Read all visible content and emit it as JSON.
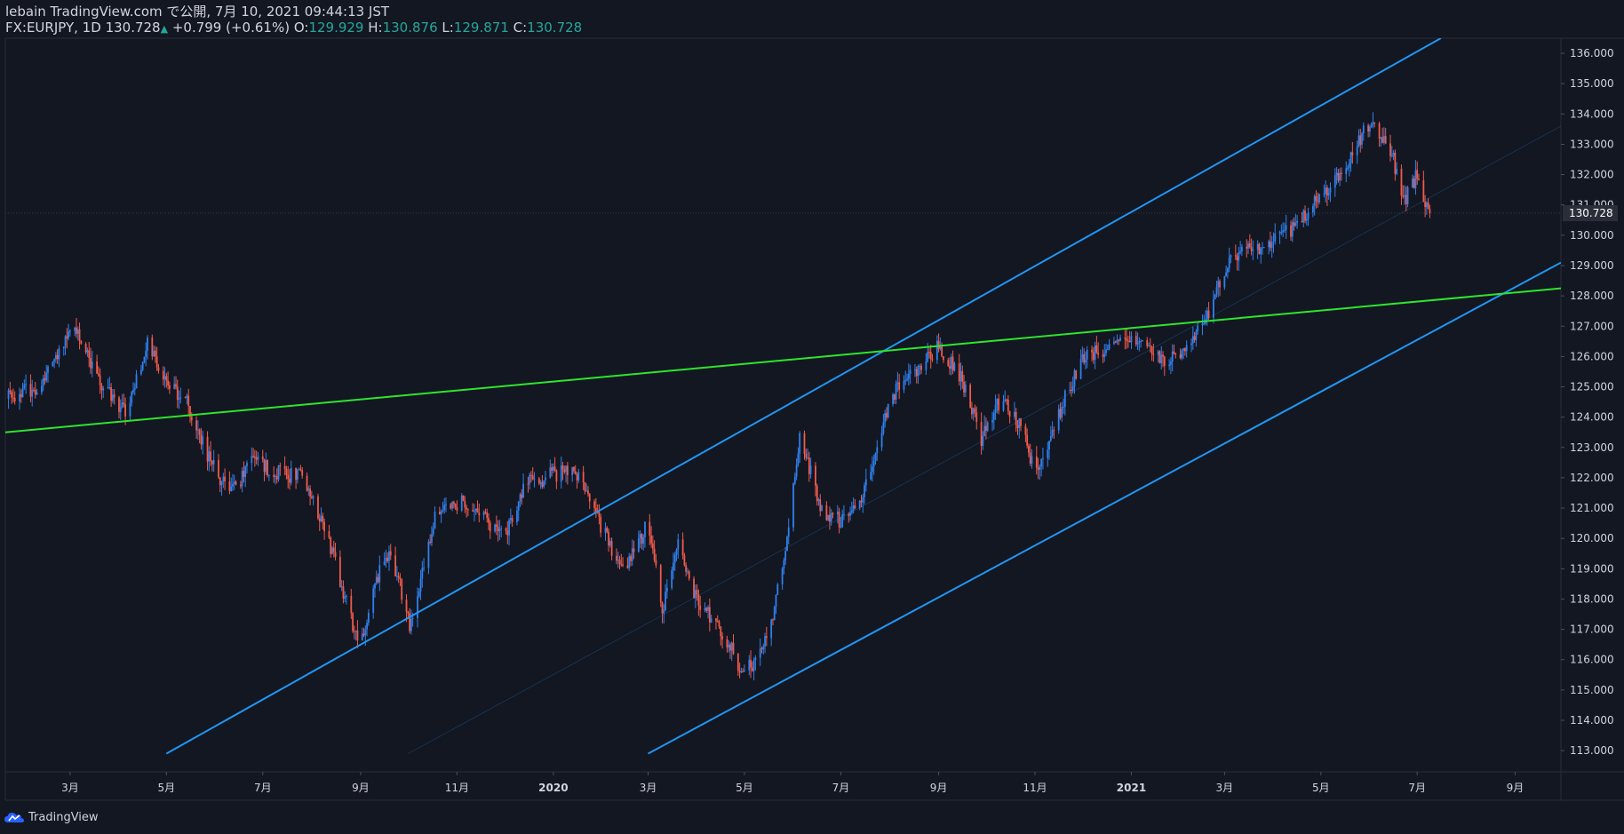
{
  "header": {
    "publish_line": "lebain TradingView.com で公開, 7月 10, 2021 09:44:13 JST",
    "symbol": "FX:EURJPY, 1D",
    "last": "130.728",
    "change_arrow": "▲",
    "change": "+0.799 (+0.61%)",
    "o_label": "O:",
    "o_value": "129.929",
    "h_label": "H:",
    "h_value": "130.876",
    "l_label": "L:",
    "l_value": "129.871",
    "c_label": "C:",
    "c_value": "130.728"
  },
  "footer": {
    "brand": "TradingView",
    "logo_icon": "tradingview-cloud-icon"
  },
  "colors": {
    "background": "#131722",
    "up": "#2f80ed",
    "down": "#f05a4a",
    "channel": "#2196f3",
    "trendline": "#2ee52e",
    "axis_text": "#d1d4dc"
  },
  "chart_data": {
    "type": "candlestick",
    "symbol": "FX:EURJPY",
    "interval": "1D",
    "y_axis": {
      "range": [
        112.3,
        136.5
      ],
      "ticks": [
        "113.000",
        "114.000",
        "115.000",
        "116.000",
        "117.000",
        "118.000",
        "119.000",
        "120.000",
        "121.000",
        "122.000",
        "123.000",
        "124.000",
        "125.000",
        "126.000",
        "127.000",
        "128.000",
        "129.000",
        "130.000",
        "131.000",
        "132.000",
        "133.000",
        "134.000",
        "135.000",
        "136.000"
      ],
      "last_price_label": "130.728"
    },
    "x_axis": {
      "range": [
        "2019-01-19",
        "2021-09-30"
      ],
      "ticks": [
        {
          "date": "2019-03-01",
          "label": "3月"
        },
        {
          "date": "2019-05-01",
          "label": "5月"
        },
        {
          "date": "2019-07-01",
          "label": "7月"
        },
        {
          "date": "2019-09-01",
          "label": "9月"
        },
        {
          "date": "2019-11-01",
          "label": "11月"
        },
        {
          "date": "2020-01-01",
          "label": "2020"
        },
        {
          "date": "2020-03-01",
          "label": "3月"
        },
        {
          "date": "2020-05-01",
          "label": "5月"
        },
        {
          "date": "2020-07-01",
          "label": "7月"
        },
        {
          "date": "2020-09-01",
          "label": "9月"
        },
        {
          "date": "2020-11-01",
          "label": "11月"
        },
        {
          "date": "2021-01-01",
          "label": "2021"
        },
        {
          "date": "2021-03-01",
          "label": "3月"
        },
        {
          "date": "2021-05-01",
          "label": "5月"
        },
        {
          "date": "2021-07-01",
          "label": "7月"
        },
        {
          "date": "2021-09-01",
          "label": "9月"
        }
      ]
    },
    "close_path": [
      {
        "date": "2019-01-19",
        "close": 124.6
      },
      {
        "date": "2019-02-10",
        "close": 125.0
      },
      {
        "date": "2019-03-02",
        "close": 127.1
      },
      {
        "date": "2019-03-20",
        "close": 125.2
      },
      {
        "date": "2019-04-05",
        "close": 124.1
      },
      {
        "date": "2019-04-19",
        "close": 126.4
      },
      {
        "date": "2019-05-01",
        "close": 125.2
      },
      {
        "date": "2019-05-15",
        "close": 124.4
      },
      {
        "date": "2019-05-25",
        "close": 123.0
      },
      {
        "date": "2019-06-10",
        "close": 121.4
      },
      {
        "date": "2019-06-25",
        "close": 122.6
      },
      {
        "date": "2019-07-10",
        "close": 122.2
      },
      {
        "date": "2019-07-25",
        "close": 122.0
      },
      {
        "date": "2019-08-10",
        "close": 120.3
      },
      {
        "date": "2019-08-22",
        "close": 118.0
      },
      {
        "date": "2019-09-01",
        "close": 116.4
      },
      {
        "date": "2019-09-10",
        "close": 118.6
      },
      {
        "date": "2019-09-20",
        "close": 119.6
      },
      {
        "date": "2019-10-02",
        "close": 117.2
      },
      {
        "date": "2019-10-18",
        "close": 120.7
      },
      {
        "date": "2019-11-05",
        "close": 121.2
      },
      {
        "date": "2019-11-20",
        "close": 120.6
      },
      {
        "date": "2019-12-01",
        "close": 120.0
      },
      {
        "date": "2019-12-15",
        "close": 121.8
      },
      {
        "date": "2020-01-01",
        "close": 122.1
      },
      {
        "date": "2020-01-15",
        "close": 122.2
      },
      {
        "date": "2020-02-01",
        "close": 120.3
      },
      {
        "date": "2020-02-15",
        "close": 118.9
      },
      {
        "date": "2020-03-01",
        "close": 120.5
      },
      {
        "date": "2020-03-10",
        "close": 117.6
      },
      {
        "date": "2020-03-20",
        "close": 119.8
      },
      {
        "date": "2020-04-01",
        "close": 117.9
      },
      {
        "date": "2020-04-15",
        "close": 117.1
      },
      {
        "date": "2020-05-01",
        "close": 115.5
      },
      {
        "date": "2020-05-15",
        "close": 116.6
      },
      {
        "date": "2020-05-25",
        "close": 119.0
      },
      {
        "date": "2020-06-05",
        "close": 123.3
      },
      {
        "date": "2020-06-20",
        "close": 120.8
      },
      {
        "date": "2020-07-01",
        "close": 120.6
      },
      {
        "date": "2020-07-15",
        "close": 121.5
      },
      {
        "date": "2020-08-01",
        "close": 124.6
      },
      {
        "date": "2020-08-20",
        "close": 125.7
      },
      {
        "date": "2020-09-01",
        "close": 126.3
      },
      {
        "date": "2020-09-15",
        "close": 125.3
      },
      {
        "date": "2020-09-28",
        "close": 123.3
      },
      {
        "date": "2020-10-10",
        "close": 124.6
      },
      {
        "date": "2020-10-25",
        "close": 123.6
      },
      {
        "date": "2020-11-01",
        "close": 122.0
      },
      {
        "date": "2020-11-15",
        "close": 124.0
      },
      {
        "date": "2020-12-01",
        "close": 126.0
      },
      {
        "date": "2020-12-15",
        "close": 126.2
      },
      {
        "date": "2021-01-05",
        "close": 126.6
      },
      {
        "date": "2021-01-20",
        "close": 125.8
      },
      {
        "date": "2021-02-05",
        "close": 126.2
      },
      {
        "date": "2021-02-20",
        "close": 127.6
      },
      {
        "date": "2021-03-05",
        "close": 129.4
      },
      {
        "date": "2021-03-20",
        "close": 129.5
      },
      {
        "date": "2021-04-01",
        "close": 129.9
      },
      {
        "date": "2021-04-15",
        "close": 130.3
      },
      {
        "date": "2021-05-01",
        "close": 131.3
      },
      {
        "date": "2021-05-15",
        "close": 132.2
      },
      {
        "date": "2021-06-01",
        "close": 133.7
      },
      {
        "date": "2021-06-15",
        "close": 132.7
      },
      {
        "date": "2021-06-22",
        "close": 131.0
      },
      {
        "date": "2021-06-30",
        "close": 131.9
      },
      {
        "date": "2021-07-09",
        "close": 130.728
      }
    ],
    "drawings": [
      {
        "name": "channel-upper",
        "color": "#2196f3",
        "from": {
          "date": "2019-05-01",
          "price": 112.9
        },
        "to": {
          "date": "2021-07-16",
          "price": 136.5
        }
      },
      {
        "name": "channel-lower",
        "color": "#2196f3",
        "from": {
          "date": "2020-03-01",
          "price": 112.9
        },
        "to": {
          "date": "2021-09-30",
          "price": 129.1
        }
      },
      {
        "name": "channel-middle",
        "color": "#2196f3",
        "from": {
          "date": "2019-10-01",
          "price": 112.9
        },
        "to": {
          "date": "2021-09-30",
          "price": 133.6
        }
      },
      {
        "name": "green-trendline",
        "color": "#2ee52e",
        "from": {
          "date": "2019-01-19",
          "price": 123.5
        },
        "to": {
          "date": "2021-09-30",
          "price": 128.25
        }
      }
    ]
  }
}
